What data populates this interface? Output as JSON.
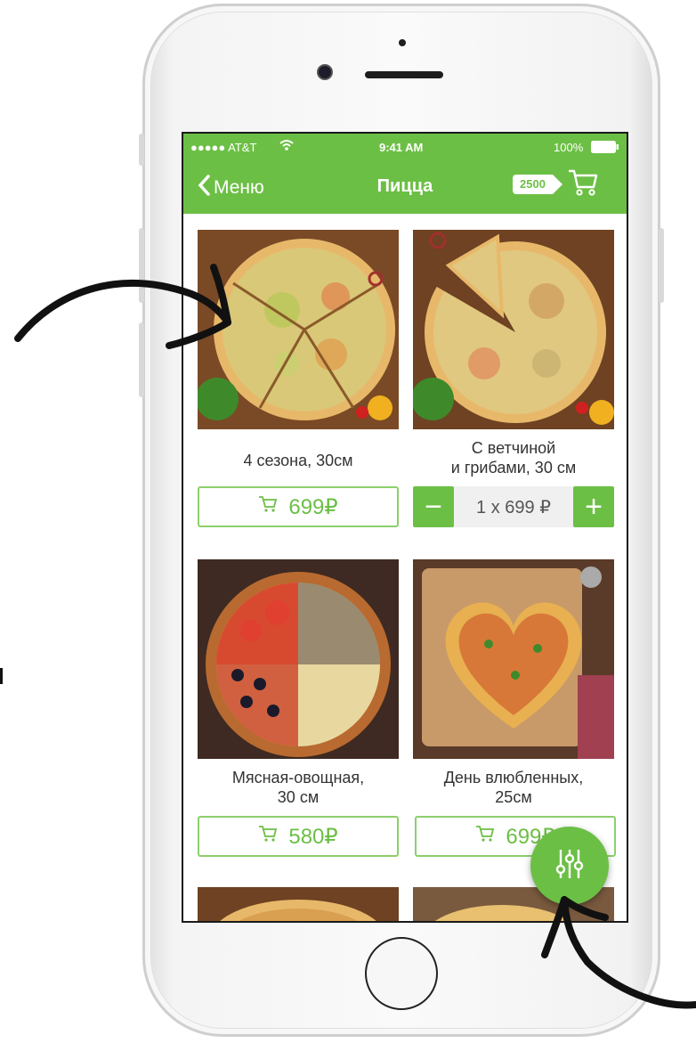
{
  "status_bar": {
    "carrier": "●●●●● AT&T",
    "time": "9:41 AM",
    "battery": "100%"
  },
  "nav": {
    "back_label": "Меню",
    "title": "Пицца",
    "cart_total": "2500"
  },
  "products": [
    {
      "name_line1": "4 сезона, 30см",
      "name_line2": "",
      "price": "699₽"
    },
    {
      "name_line1": "С ветчиной",
      "name_line2": "и грибами, 30 см",
      "stepper_value": "1 x 699 ₽"
    },
    {
      "name_line1": "Мясная-овощная,",
      "name_line2": "30 см",
      "price": "580₽"
    },
    {
      "name_line1": "День влюбленных,",
      "name_line2": "25см",
      "price": "699₽"
    }
  ],
  "stepper": {
    "minus": "−",
    "plus": "+"
  },
  "icons": {
    "cart": "cart-icon",
    "filter": "sliders-icon",
    "back": "chevron-left-icon",
    "wifi": "wifi-icon",
    "battery": "battery-icon"
  },
  "colors": {
    "accent": "#6cbf45",
    "accent_border": "#8ccf6c"
  }
}
